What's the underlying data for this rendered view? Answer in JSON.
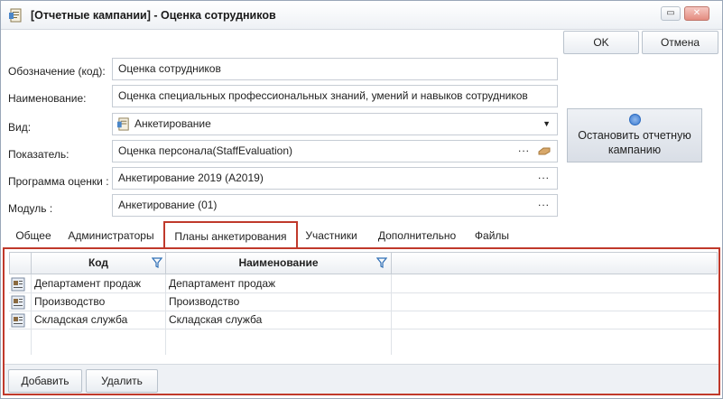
{
  "window": {
    "title": "[Отчетные кампании] - Оценка сотрудников",
    "minimize": "▭",
    "close": "✕"
  },
  "toolbar": {
    "ok_label": "OK",
    "cancel_label": "Отмена"
  },
  "form": {
    "code_label": "Обозначение (код):",
    "code_value": "Оценка сотрудников",
    "name_label": "Наименование:",
    "name_value": "Оценка специальных профессиональных знаний, умений и навыков сотрудников",
    "kind_label": "Вид:",
    "kind_value": "Анкетирование",
    "indicator_label": "Показатель:",
    "indicator_value": "Оценка персонала(StaffEvaluation)",
    "program_label": "Программа оценки :",
    "program_value": "Анкетирование 2019 (А2019)",
    "module_label": "Модуль :",
    "module_value": "Анкетирование (01)",
    "ellipsis": "...",
    "dropdown_arrow": "▼"
  },
  "stop_button": {
    "label_line1": "Остановить отчетную",
    "label_line2": "кампанию",
    "icon": "stop-circle-icon"
  },
  "tabs": [
    {
      "label": "Общее"
    },
    {
      "label": "Администраторы"
    },
    {
      "label": "Планы анкетирования",
      "active": true
    },
    {
      "label": "Участники"
    },
    {
      "label": "Дополнительно"
    },
    {
      "label": "Файлы"
    }
  ],
  "grid": {
    "columns": [
      "Код",
      "Наименование"
    ],
    "rows": [
      {
        "code": "Департамент продаж",
        "name": "Департамент продаж"
      },
      {
        "code": "Производство",
        "name": "Производство"
      },
      {
        "code": "Складская служба",
        "name": "Складская служба"
      }
    ]
  },
  "footer": {
    "add_label": "Добавить",
    "delete_label": "Удалить"
  },
  "colors": {
    "accent_red": "#c0392b",
    "button_blue": "#3b7ad0"
  }
}
